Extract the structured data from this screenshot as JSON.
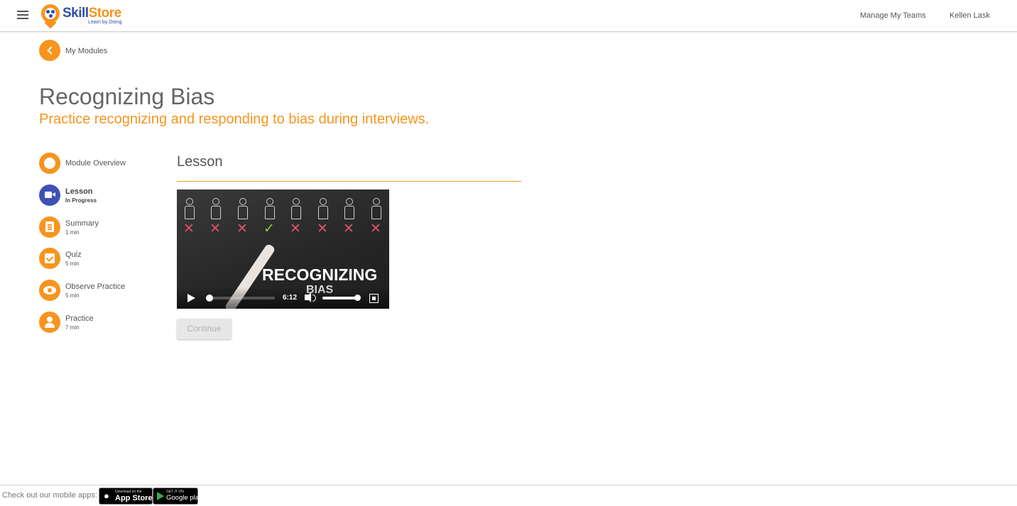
{
  "header": {
    "logo": {
      "word_a": "Skill",
      "word_b": "Store",
      "tagline": "Learn by Doing"
    },
    "nav": {
      "manage_teams": "Manage My Teams",
      "user_name": "Kellen Lask"
    },
    "icons": {
      "menu": "hamburger-menu-icon",
      "logo": "skillstore-pin-logo"
    }
  },
  "breadcrumb": {
    "back_label": "My Modules",
    "icon": "chevron-left-icon"
  },
  "page": {
    "title": "Recognizing Bias",
    "subtitle": "Practice recognizing and responding to bias during interviews."
  },
  "steps": [
    {
      "label": "Module Overview",
      "sub": "",
      "icon": "circle-icon",
      "active": false
    },
    {
      "label": "Lesson",
      "sub": "In Progress",
      "icon": "video-camera-icon",
      "active": true
    },
    {
      "label": "Summary",
      "sub": "1 min",
      "icon": "clipboard-icon",
      "active": false
    },
    {
      "label": "Quiz",
      "sub": "5 min",
      "icon": "checkbox-icon",
      "active": false
    },
    {
      "label": "Observe Practice",
      "sub": "5 min",
      "icon": "eye-icon",
      "active": false
    },
    {
      "label": "Practice",
      "sub": "7 min",
      "icon": "person-icon",
      "active": false
    }
  ],
  "lesson": {
    "section_title": "Lesson",
    "video": {
      "overlay_title": "RECOGNIZING",
      "overlay_sub": "BIAS",
      "time": "6:12",
      "progress": 0.05,
      "volume": 1.0,
      "figure_marks": [
        "✕",
        "✕",
        "✕",
        "✓",
        "✕",
        "✕",
        "✕",
        "✕"
      ]
    },
    "continue_label": "Continue"
  },
  "footer": {
    "text": "Check out our mobile apps:",
    "app_store": {
      "small": "Download on the",
      "big": "App Store"
    },
    "google_play": {
      "small": "GET IT ON",
      "big": "Google play"
    }
  },
  "colors": {
    "accent": "#f7941d",
    "active_step": "#3f51b5",
    "brand_blue": "#2a4fa8"
  }
}
